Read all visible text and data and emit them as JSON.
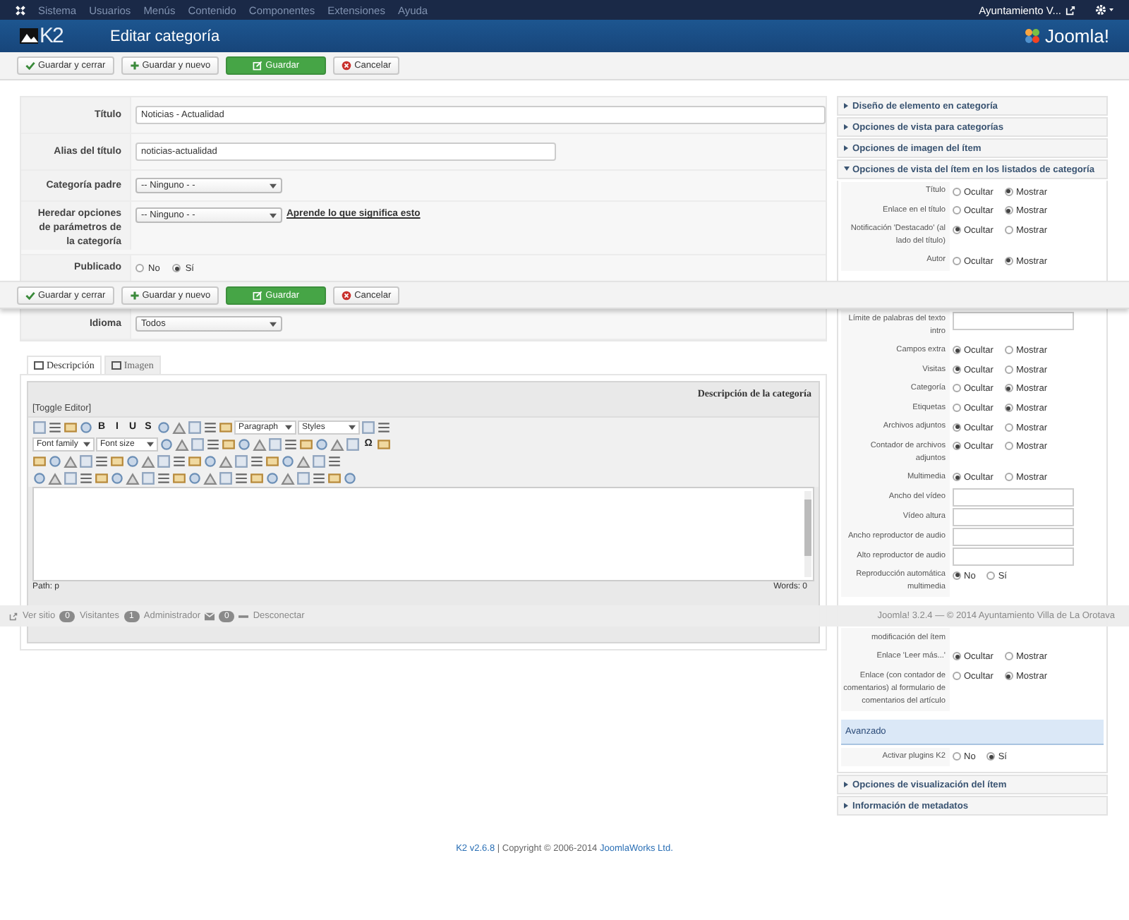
{
  "topbar": {
    "menu": [
      "Sistema",
      "Usuarios",
      "Menús",
      "Contenido",
      "Componentes",
      "Extensiones",
      "Ayuda"
    ],
    "user": "Ayuntamiento V..."
  },
  "header": {
    "logo": "K2",
    "title": "Editar categoría",
    "brand": "Joomla!"
  },
  "toolbar": [
    {
      "kind": "check",
      "label": "Guardar y cerrar"
    },
    {
      "kind": "plus",
      "label": "Guardar y nuevo"
    },
    {
      "kind": "save",
      "label": "Guardar"
    },
    {
      "kind": "cancel",
      "label": "Cancelar"
    }
  ],
  "form": [
    [
      {
        "kind": "wide",
        "label": "Título",
        "value": "Noticias - Actualidad"
      },
      {
        "kind": "text",
        "label": "Alias del título",
        "value": "noticias-actualidad"
      },
      {
        "kind": "select",
        "label": "Categoría padre",
        "value": "-- Ninguno - -"
      },
      {
        "kind": "select",
        "label": "Heredar opciones de parámetros de la categoría",
        "value": "-- Ninguno - -",
        "link": "Aprende lo que significa esto"
      },
      {
        "kind": "radio",
        "label": "Publicado",
        "options": [
          {
            "label": "No",
            "selected": false
          },
          {
            "label": "Sí",
            "selected": true
          }
        ]
      }
    ],
    [
      {
        "kind": "select",
        "label": "Idioma",
        "value": "Todos"
      }
    ]
  ],
  "tabs": [
    {
      "label": "Descripción",
      "selected": true
    },
    {
      "label": "Imagen",
      "selected": false
    }
  ],
  "editor": {
    "heading": "Descripción de la categoría",
    "toggle": "[Toggle Editor]",
    "toolbar_rows": [
      [
        {
          "kind": "icon"
        },
        {
          "kind": "icon"
        },
        {
          "kind": "icon"
        },
        {
          "kind": "icon"
        },
        {
          "kind": "glyph",
          "label": "B"
        },
        {
          "kind": "glyph",
          "label": "I"
        },
        {
          "kind": "glyph",
          "label": "U"
        },
        {
          "kind": "glyph",
          "label": "S"
        },
        {
          "kind": "icon"
        },
        {
          "kind": "icon"
        },
        {
          "kind": "icon"
        },
        {
          "kind": "icon"
        },
        {
          "kind": "icon"
        },
        {
          "kind": "select",
          "label": "Paragraph"
        },
        {
          "kind": "select",
          "label": "Styles"
        },
        {
          "kind": "icon"
        },
        {
          "kind": "icon"
        }
      ],
      [
        {
          "kind": "select",
          "label": "Font family"
        },
        {
          "kind": "select",
          "label": "Font size"
        },
        {
          "kind": "icon"
        },
        {
          "kind": "icon"
        },
        {
          "kind": "icon"
        },
        {
          "kind": "icon"
        },
        {
          "kind": "icon"
        },
        {
          "kind": "icon"
        },
        {
          "kind": "icon"
        },
        {
          "kind": "icon"
        },
        {
          "kind": "icon"
        },
        {
          "kind": "icon"
        },
        {
          "kind": "icon"
        },
        {
          "kind": "icon"
        },
        {
          "kind": "icon"
        },
        {
          "kind": "glyph",
          "label": "Ω"
        },
        {
          "kind": "icon"
        }
      ],
      [
        {
          "kind": "icon"
        },
        {
          "kind": "icon"
        },
        {
          "kind": "icon"
        },
        {
          "kind": "icon"
        },
        {
          "kind": "icon"
        },
        {
          "kind": "icon"
        },
        {
          "kind": "icon"
        },
        {
          "kind": "icon"
        },
        {
          "kind": "icon"
        },
        {
          "kind": "icon"
        },
        {
          "kind": "icon"
        },
        {
          "kind": "icon"
        },
        {
          "kind": "icon"
        },
        {
          "kind": "icon"
        },
        {
          "kind": "icon"
        },
        {
          "kind": "icon"
        },
        {
          "kind": "icon"
        },
        {
          "kind": "icon"
        },
        {
          "kind": "icon"
        },
        {
          "kind": "icon"
        }
      ],
      [
        {
          "kind": "icon"
        },
        {
          "kind": "icon"
        },
        {
          "kind": "icon"
        },
        {
          "kind": "icon"
        },
        {
          "kind": "icon"
        },
        {
          "kind": "icon"
        },
        {
          "kind": "icon"
        },
        {
          "kind": "icon"
        },
        {
          "kind": "icon"
        },
        {
          "kind": "icon"
        },
        {
          "kind": "icon"
        },
        {
          "kind": "icon"
        },
        {
          "kind": "icon"
        },
        {
          "kind": "icon"
        },
        {
          "kind": "icon"
        },
        {
          "kind": "icon"
        },
        {
          "kind": "icon"
        },
        {
          "kind": "icon"
        },
        {
          "kind": "icon"
        },
        {
          "kind": "icon"
        },
        {
          "kind": "icon"
        }
      ]
    ],
    "path": "Path: p",
    "words": "Words: 0"
  },
  "floating_toolbar": [
    {
      "kind": "check",
      "label": "Guardar y cerrar"
    },
    {
      "kind": "plus",
      "label": "Guardar y nuevo"
    },
    {
      "kind": "save",
      "label": "Guardar"
    },
    {
      "kind": "cancel",
      "label": "Cancelar"
    }
  ],
  "status_bar": {
    "view_site": "Ver sitio",
    "visitors_count": "0",
    "visitors": "Visitantes",
    "admins_count": "1",
    "admins": "Administrador",
    "messages_count": "0",
    "logout": "Desconectar",
    "version": "Joomla! 3.2.4 — © 2014 Ayuntamiento Villa de La Orotava"
  },
  "sections": [
    {
      "title": "Diseño de elemento en categoría",
      "expanded": false
    },
    {
      "title": "Opciones de vista para categorías",
      "expanded": false
    },
    {
      "title": "Opciones de imagen del ítem",
      "expanded": false
    },
    {
      "title": "Opciones de vista del ítem en los listados de categoría",
      "expanded": true,
      "segments": [
        [
          {
            "kind": "radio",
            "label": "Título",
            "options": [
              {
                "label": "Ocultar",
                "selected": false
              },
              {
                "label": "Mostrar",
                "selected": true
              }
            ]
          },
          {
            "kind": "radio",
            "label": "Enlace en el título",
            "options": [
              {
                "label": "Ocultar",
                "selected": false
              },
              {
                "label": "Mostrar",
                "selected": true
              }
            ]
          },
          {
            "kind": "radio",
            "label": "Notificación 'Destacado' (al lado del título)",
            "options": [
              {
                "label": "Ocultar",
                "selected": true
              },
              {
                "label": "Mostrar",
                "selected": false
              }
            ]
          },
          {
            "kind": "radio",
            "label": "Autor",
            "options": [
              {
                "label": "Ocultar",
                "selected": false
              },
              {
                "label": "Mostrar",
                "selected": true
              }
            ]
          }
        ],
        [
          {
            "kind": "field",
            "label": "Límite de palabras del texto intro"
          },
          {
            "kind": "radio",
            "label": "Campos extra",
            "options": [
              {
                "label": "Ocultar",
                "selected": true
              },
              {
                "label": "Mostrar",
                "selected": false
              }
            ]
          },
          {
            "kind": "radio",
            "label": "Visitas",
            "options": [
              {
                "label": "Ocultar",
                "selected": true
              },
              {
                "label": "Mostrar",
                "selected": false
              }
            ]
          },
          {
            "kind": "radio",
            "label": "Categoría",
            "options": [
              {
                "label": "Ocultar",
                "selected": false
              },
              {
                "label": "Mostrar",
                "selected": true
              }
            ]
          },
          {
            "kind": "radio",
            "label": "Etiquetas",
            "options": [
              {
                "label": "Ocultar",
                "selected": false
              },
              {
                "label": "Mostrar",
                "selected": true
              }
            ]
          },
          {
            "kind": "radio",
            "label": "Archivos adjuntos",
            "options": [
              {
                "label": "Ocultar",
                "selected": true
              },
              {
                "label": "Mostrar",
                "selected": false
              }
            ]
          },
          {
            "kind": "radio",
            "label": "Contador de archivos adjuntos",
            "options": [
              {
                "label": "Ocultar",
                "selected": true
              },
              {
                "label": "Mostrar",
                "selected": false
              }
            ]
          },
          {
            "kind": "radio",
            "label": "Multimedia",
            "options": [
              {
                "label": "Ocultar",
                "selected": true
              },
              {
                "label": "Mostrar",
                "selected": false
              }
            ]
          },
          {
            "kind": "field",
            "label": "Ancho del vídeo"
          },
          {
            "kind": "field",
            "label": "Vídeo altura"
          },
          {
            "kind": "field",
            "label": "Ancho reproductor de audio"
          },
          {
            "kind": "field",
            "label": "Alto reproductor de audio"
          },
          {
            "kind": "radio",
            "label": "Reproducción automática multimedia",
            "options": [
              {
                "label": "No",
                "selected": true
              },
              {
                "label": "Sí",
                "selected": false
              }
            ]
          }
        ],
        [
          {
            "kind": "label",
            "label": "modificación del ítem"
          },
          {
            "kind": "radio",
            "label": "Enlace 'Leer más...'",
            "options": [
              {
                "label": "Ocultar",
                "selected": true
              },
              {
                "label": "Mostrar",
                "selected": false
              }
            ]
          },
          {
            "kind": "radio",
            "label": "Enlace (con contador de comentarios) al formulario de comentarios del artículo",
            "options": [
              {
                "label": "Ocultar",
                "selected": false
              },
              {
                "label": "Mostrar",
                "selected": true
              }
            ]
          }
        ]
      ],
      "advanced": {
        "title": "Avanzado",
        "rows": [
          {
            "kind": "radio",
            "label": "Activar plugins K2",
            "options": [
              {
                "label": "No",
                "selected": false
              },
              {
                "label": "Sí",
                "selected": true
              }
            ]
          }
        ]
      }
    },
    {
      "title": "Opciones de visualización del ítem",
      "expanded": false
    },
    {
      "title": "Información de metadatos",
      "expanded": false
    }
  ],
  "footer": {
    "version_link": "K2 v2.6.8",
    "text": "| Copyright © 2006-2014",
    "company_link": "JoomlaWorks Ltd."
  }
}
